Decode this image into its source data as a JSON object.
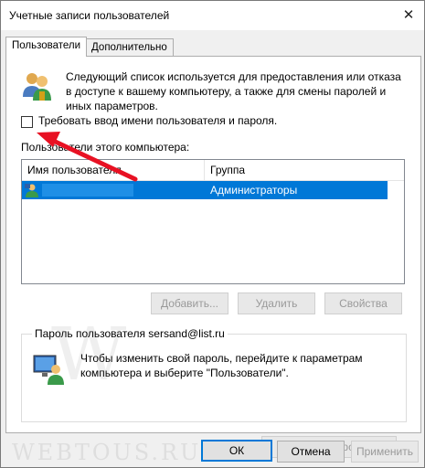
{
  "window": {
    "title": "Учетные записи пользователей",
    "close_glyph": "✕"
  },
  "tabs": [
    {
      "label": "Пользователи"
    },
    {
      "label": "Дополнительно"
    }
  ],
  "main": {
    "description": "Следующий список используется для предоставления или отказа в доступе к вашему компьютеру, а также для смены паролей и иных параметров.",
    "checkbox_label": "Требовать ввод имени пользователя и пароля.",
    "list_caption": "Пользователи этого компьютера:",
    "columns": {
      "name": "Имя пользователя",
      "group": "Группа"
    },
    "rows": [
      {
        "group": "Администраторы"
      }
    ],
    "buttons": {
      "add": "Добавить...",
      "remove": "Удалить",
      "properties": "Свойства"
    }
  },
  "password_group": {
    "title": "Пароль пользователя sersand@list.ru",
    "text": "Чтобы изменить свой пароль, перейдите к параметрам компьютера и выберите \"Пользователи\".",
    "change_button": "Сменить пароль..."
  },
  "footer": {
    "ok": "ОК",
    "cancel": "Отмена",
    "apply": "Применить"
  },
  "watermark": {
    "w": "W",
    "text": "WEBTOUS.RU"
  },
  "colors": {
    "selection": "#0078d7",
    "arrow": "#e81123"
  }
}
